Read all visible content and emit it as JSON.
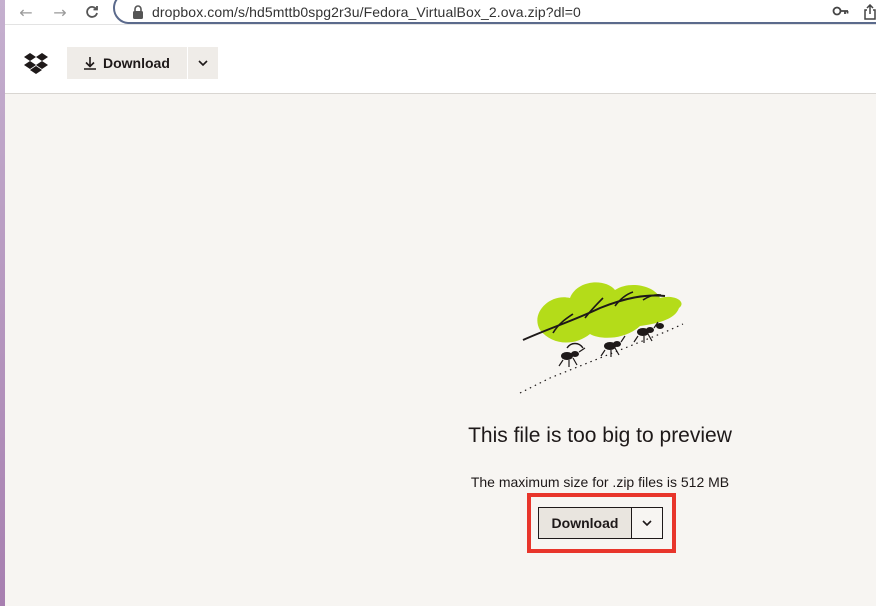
{
  "browser": {
    "url": "dropbox.com/s/hd5mttb0spg2r3u/Fedora_VirtualBox_2.ova.zip?dl=0",
    "icons": [
      "back-arrow-icon",
      "forward-arrow-icon",
      "reload-icon",
      "lock-icon",
      "key-icon",
      "share-icon"
    ]
  },
  "header": {
    "logo": "dropbox-logo",
    "download_label": "Download"
  },
  "preview": {
    "title": "This file is too big to preview",
    "subtitle": "The maximum size for .zip files is 512 MB",
    "download_label": "Download"
  },
  "colors": {
    "background": "#f7f5f2",
    "leaf_green": "#b4dc19",
    "highlight_red": "#e8352b",
    "text": "#1e1919"
  }
}
